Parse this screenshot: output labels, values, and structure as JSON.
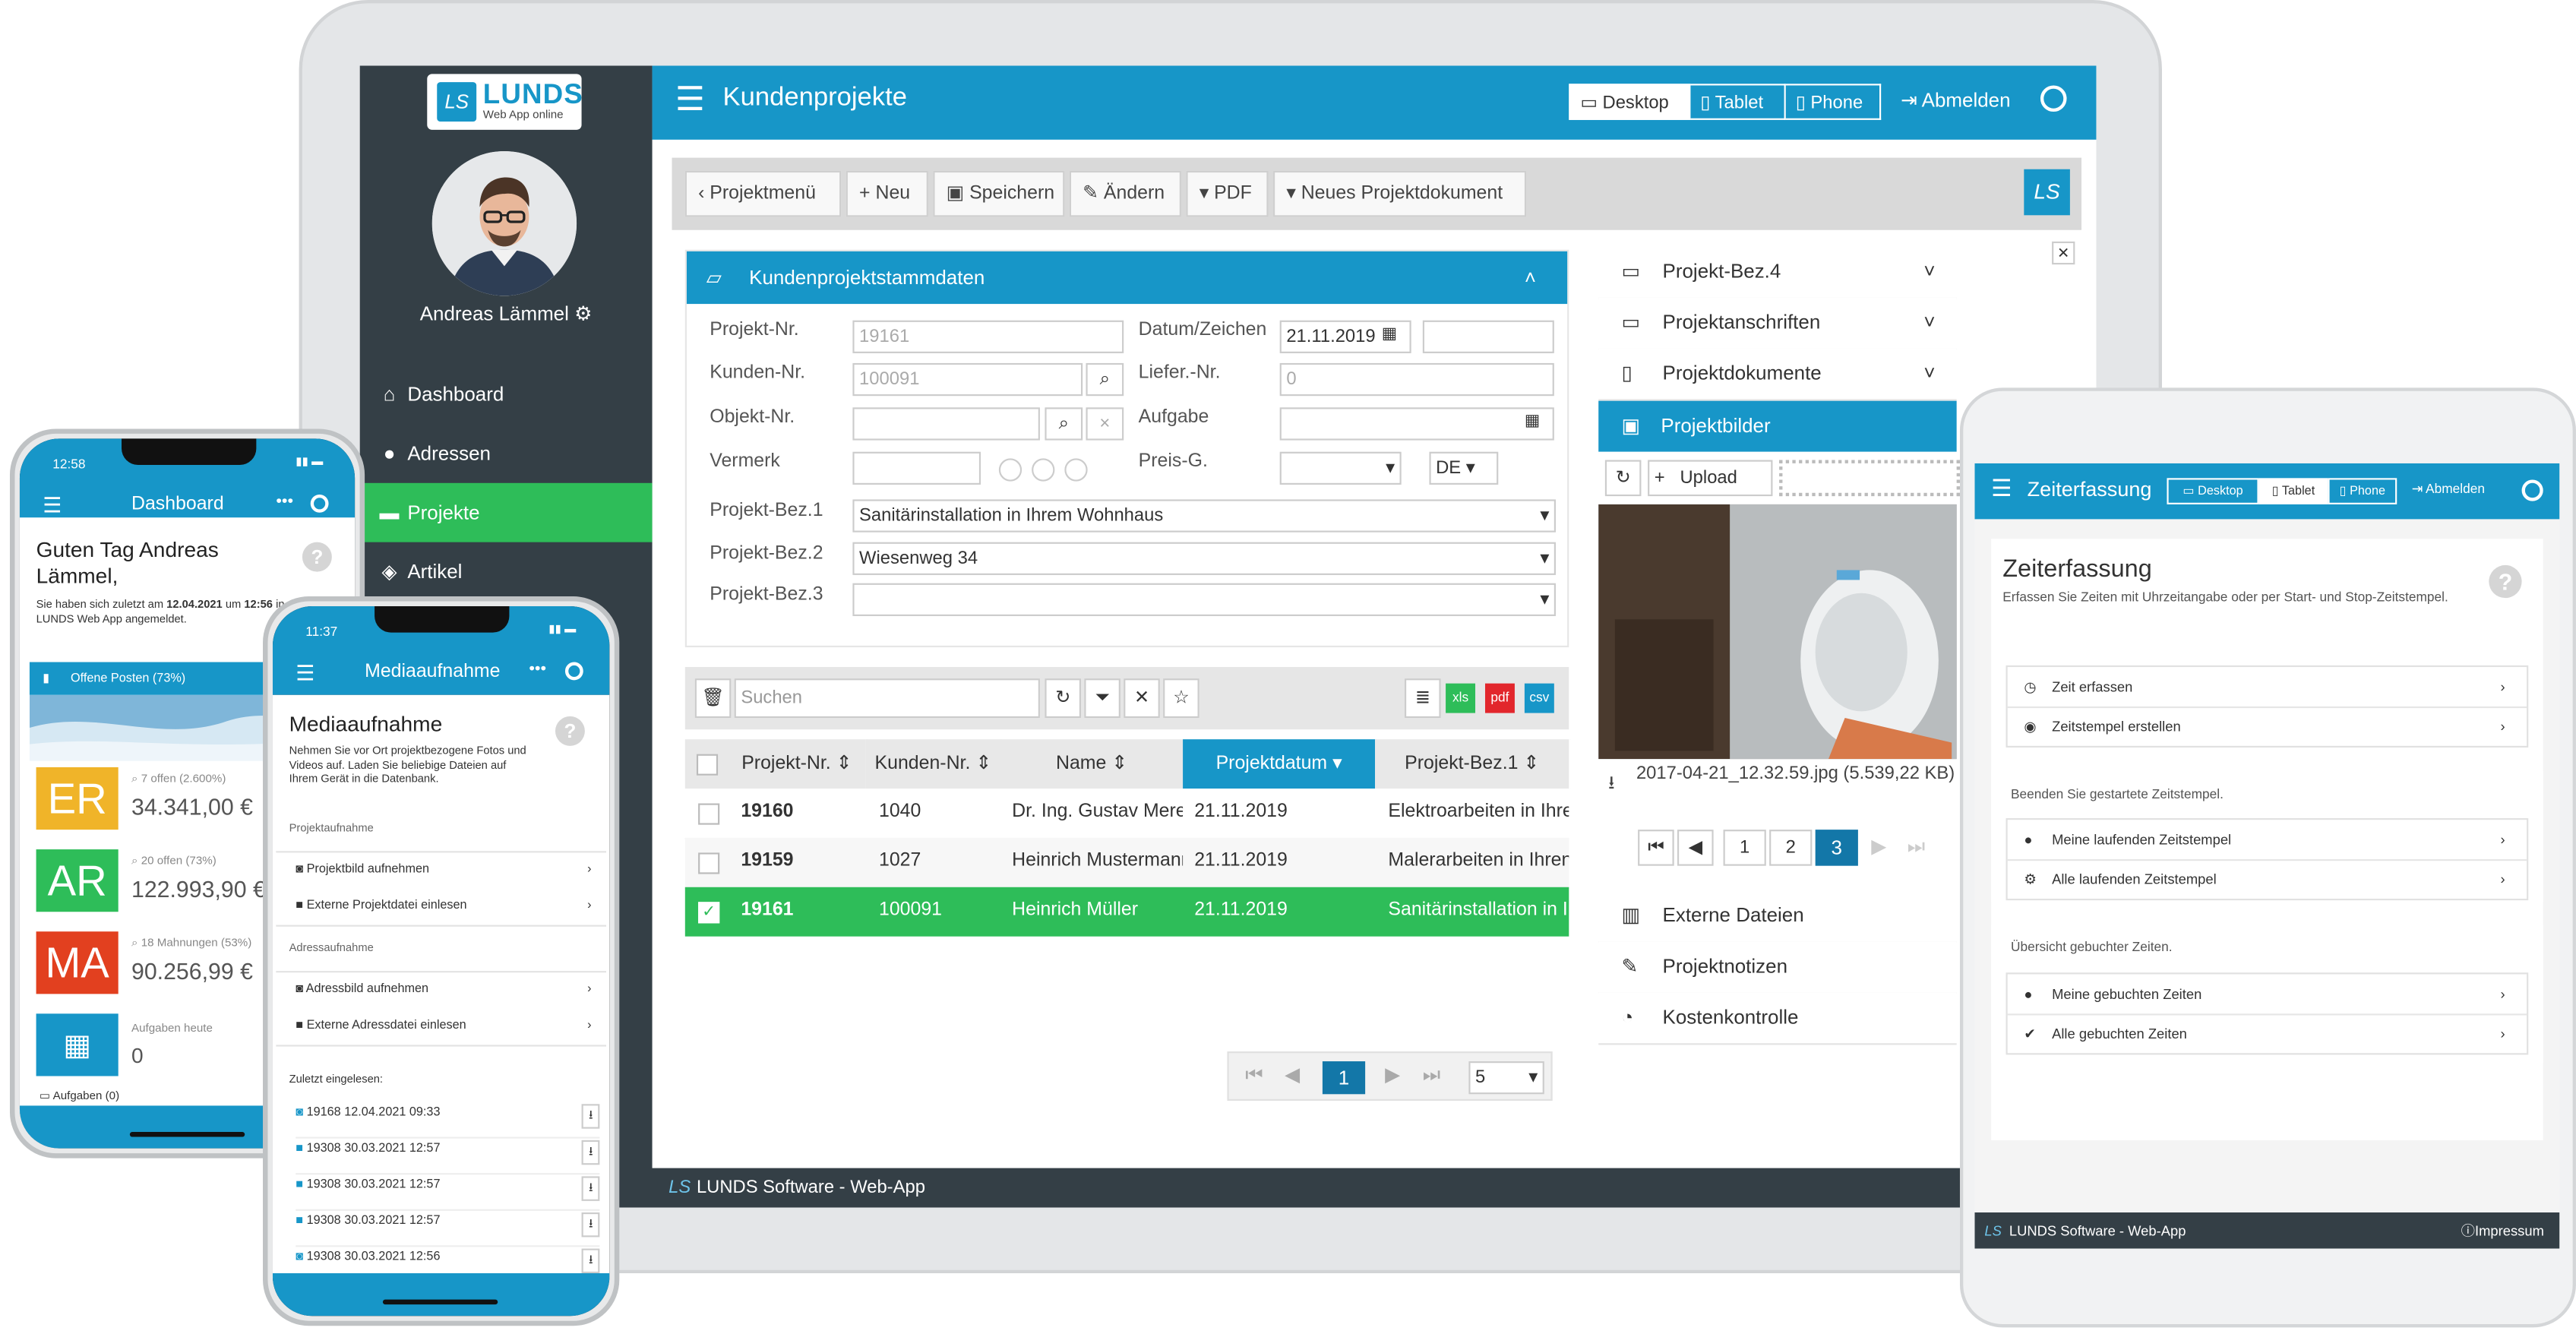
{
  "laptop": {
    "logo": {
      "mark": "LS",
      "name": "LUNDS",
      "sub": "Web App online"
    },
    "user_name": "Andreas Lämmel",
    "nav": [
      {
        "label": "Dashboard",
        "icon": "home-icon"
      },
      {
        "label": "Adressen",
        "icon": "user-icon"
      },
      {
        "label": "Projekte",
        "icon": "folder-icon",
        "active": true
      },
      {
        "label": "Artikel",
        "icon": "cube-icon"
      }
    ],
    "header": {
      "title": "Kundenprojekte",
      "views": [
        "Desktop",
        "Tablet",
        "Phone"
      ],
      "logout": "Abmelden"
    },
    "toolbar": [
      "Projektmenü",
      "Neu",
      "Speichern",
      "Ändern",
      "PDF",
      "Neues Projektdokument"
    ],
    "form": {
      "title": "Kundenprojektstammdaten",
      "projekt_nr_label": "Projekt-Nr.",
      "projekt_nr": "19161",
      "kunden_nr_label": "Kunden-Nr.",
      "kunden_nr": "100091",
      "objekt_nr_label": "Objekt-Nr.",
      "vermerk_label": "Vermerk",
      "datum_label": "Datum/Zeichen",
      "datum": "21.11.2019",
      "liefer_label": "Liefer.-Nr.",
      "liefer": "0",
      "aufgabe_label": "Aufgabe",
      "preis_label": "Preis-G.",
      "lang": "DE",
      "bez1_label": "Projekt-Bez.1",
      "bez1": "Sanitärinstallation in Ihrem Wohnhaus",
      "bez2_label": "Projekt-Bez.2",
      "bez2": "Wiesenweg 34",
      "bez3_label": "Projekt-Bez.3",
      "bez3": ""
    },
    "grid": {
      "search_placeholder": "Suchen",
      "exports": [
        "xls",
        "pdf",
        "csv"
      ],
      "columns": [
        "Projekt-Nr.",
        "Kunden-Nr.",
        "Name",
        "Projektdatum",
        "Projekt-Bez.1"
      ],
      "rows": [
        {
          "nr": "19160",
          "kunde": "1040",
          "name": "Dr. Ing. Gustav Mere",
          "datum": "21.11.2019",
          "bez": "Elektroarbeiten in Ihre"
        },
        {
          "nr": "19159",
          "kunde": "1027",
          "name": "Heinrich Mustermann",
          "datum": "21.11.2019",
          "bez": "Malerarbeiten in Ihren"
        },
        {
          "nr": "19161",
          "kunde": "100091",
          "name": "Heinrich Müller",
          "datum": "21.11.2019",
          "bez": "Sanitärinstallation in I",
          "selected": true
        }
      ],
      "page": "1",
      "page_size": "5"
    },
    "side_panel": {
      "items_top": [
        "Projekt-Bez.4",
        "Projektanschriften",
        "Projektdokumente"
      ],
      "active": "Projektbilder",
      "upload": "Upload",
      "file_caption": "2017-04-21_12.32.59.jpg (5.539,22 KB)",
      "pages": [
        "1",
        "2",
        "3"
      ],
      "current_page": "3",
      "items_bottom": [
        "Externe Dateien",
        "Projektnotizen",
        "Kostenkontrolle"
      ]
    },
    "footer": "LUNDS Software - Web-App"
  },
  "tablet": {
    "header": {
      "title": "Zeiterfassung",
      "views": [
        "Desktop",
        "Tablet",
        "Phone"
      ],
      "logout": "Abmelden"
    },
    "title": "Zeiterfassung",
    "subtitle": "Erfassen Sie Zeiten mit Uhrzeitangabe oder per Start- und Stop-Zeitstempel.",
    "group1": [
      "Zeit erfassen",
      "Zeitstempel erstellen"
    ],
    "caption2": "Beenden Sie gestartete Zeitstempel.",
    "group2": [
      "Meine laufenden Zeitstempel",
      "Alle laufenden Zeitstempel"
    ],
    "caption3": "Übersicht gebuchter Zeiten.",
    "group3": [
      "Meine gebuchten Zeiten",
      "Alle gebuchten Zeiten"
    ],
    "footer": "LUNDS Software - Web-App",
    "impressum": "Impressum"
  },
  "phone1": {
    "time": "12:58",
    "title": "Dashboard",
    "greeting": "Guten Tag Andreas Lämmel,",
    "info_pre": "Sie haben sich zuletzt am",
    "info_date": "12.04.2021",
    "info_mid": "um",
    "info_time": "12:56",
    "info_post": "in der LUNDS Web App angemeldet.",
    "banner": "Offene Posten (73%)",
    "tiles": [
      {
        "code": "ER",
        "color": "#f0b429",
        "sub": "7 offen (2.600%)",
        "value": "34.341,00 €"
      },
      {
        "code": "AR",
        "color": "#2ebd59",
        "sub": "20 offen (73%)",
        "value": "122.993,90 €"
      },
      {
        "code": "MA",
        "color": "#e2401f",
        "sub": "18 Mahnungen (53%)",
        "value": "90.256,99 €"
      },
      {
        "code": "",
        "color": "#1796c8",
        "sub": "Aufgaben heute",
        "value": "0"
      }
    ],
    "bottom": "Aufgaben (0)"
  },
  "phone2": {
    "time": "11:37",
    "title": "Mediaaufnahme",
    "heading": "Mediaaufnahme",
    "desc": "Nehmen Sie vor Ort projektbezogene Fotos und Videos auf. Laden Sie beliebige Dateien auf Ihrem Gerät in die Datenbank.",
    "sec1": "Projektaufnahme",
    "items1": [
      "Projektbild aufnehmen",
      "Externe Projektdatei einlesen"
    ],
    "sec2": "Adressaufnahme",
    "items2": [
      "Adressbild aufnehmen",
      "Externe Adressdatei einlesen"
    ],
    "sec3": "Zuletzt eingelesen:",
    "recent": [
      "19168 12.04.2021 09:33",
      "19308 30.03.2021 12:57",
      "19308 30.03.2021 12:57",
      "19308 30.03.2021 12:57",
      "19308 30.03.2021 12:56"
    ]
  }
}
